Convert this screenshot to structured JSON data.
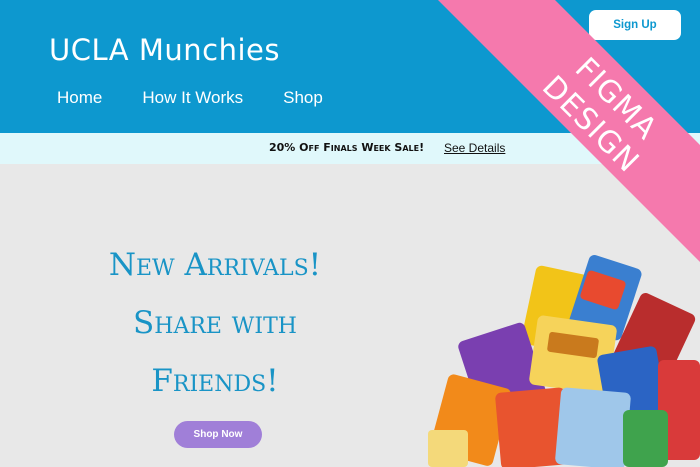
{
  "header": {
    "title": "UCLA Munchies",
    "nav": [
      "Home",
      "How It Works",
      "Shop"
    ],
    "signup_label": "Sign Up",
    "bg_color": "#0d98cf"
  },
  "promo": {
    "text": "20% Off Finals Week Sale!",
    "link": "See Details"
  },
  "hero": {
    "lines": [
      "New Arrivals!",
      "Share with",
      "Friends!"
    ],
    "button_label": "Shop Now",
    "text_color": "#1994c6",
    "button_color": "#a07fd8"
  },
  "corner_banner": {
    "line1": "FIGMA",
    "line2": "DESIGN",
    "color": "#f579ad"
  }
}
